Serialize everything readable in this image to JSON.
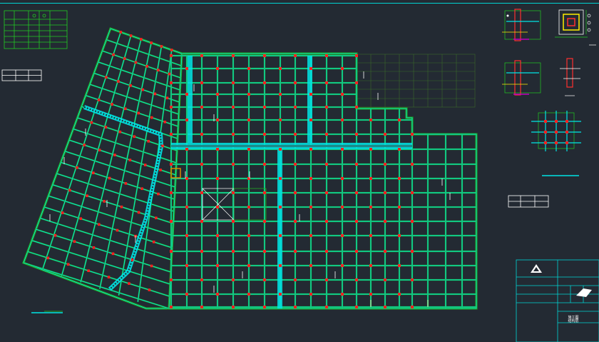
{
  "drawing": {
    "type": "structural floor plan (beam layout)",
    "colors": {
      "background": "#232a33",
      "frame_line": "#00d4d4",
      "grid_line": "#22aa22",
      "beam": "#00e5e5",
      "column": "#ff2020",
      "dim_line": "#34c634",
      "accent_magenta": "#c000c0",
      "accent_yellow": "#ffee00",
      "text_white": "#ffffff"
    }
  },
  "title_block": {
    "text": "施工图\n结构层"
  },
  "icons": {
    "logo": "company-logo-icon",
    "stamp": "stamp-icon"
  }
}
